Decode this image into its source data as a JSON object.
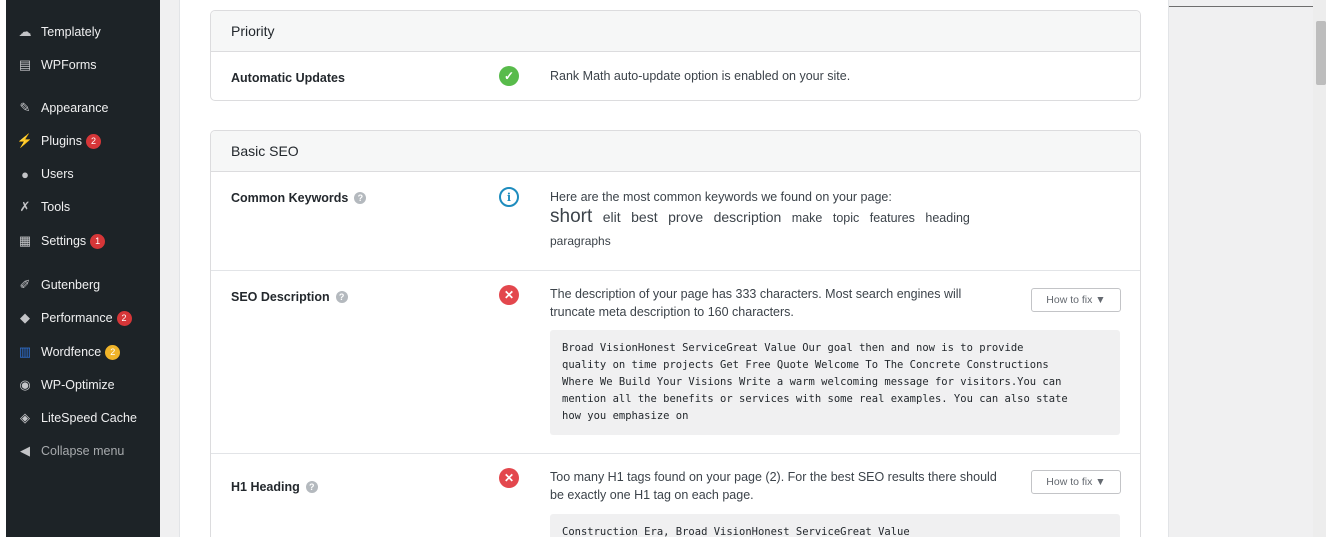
{
  "sidebar": {
    "items": [
      {
        "label": "Templately",
        "icon": "templately-icon"
      },
      {
        "label": "WPForms",
        "icon": "wpforms-icon"
      },
      {
        "label": "Appearance",
        "icon": "paintbrush-icon"
      },
      {
        "label": "Plugins",
        "icon": "plugin-icon",
        "badge": "2"
      },
      {
        "label": "Users",
        "icon": "users-icon"
      },
      {
        "label": "Tools",
        "icon": "wrench-icon"
      },
      {
        "label": "Settings",
        "icon": "settings-icon",
        "badge": "1"
      },
      {
        "label": "Gutenberg",
        "icon": "pencil-icon"
      },
      {
        "label": "Performance",
        "icon": "gauge-icon",
        "badge": "2"
      },
      {
        "label": "Wordfence",
        "icon": "wordfence-icon",
        "badge": "2"
      },
      {
        "label": "WP-Optimize",
        "icon": "optimize-icon"
      },
      {
        "label": "LiteSpeed Cache",
        "icon": "litespeed-icon"
      },
      {
        "label": "Collapse menu",
        "icon": "collapse-icon"
      }
    ]
  },
  "priority": {
    "title": "Priority",
    "auto_updates": {
      "label": "Automatic Updates",
      "message": "Rank Math auto-update option is enabled on your site."
    }
  },
  "basic_seo": {
    "title": "Basic SEO",
    "common_keywords": {
      "label": "Common Keywords",
      "message": "Here are the most common keywords we found on your page:",
      "keywords": [
        "short",
        "elit",
        "best",
        "prove",
        "description",
        "make",
        "topic",
        "features",
        "heading",
        "paragraphs"
      ]
    },
    "seo_description": {
      "label": "SEO Description",
      "message_line1": "The description of your page has 333 characters. Most search engines will",
      "message_line2": "truncate meta description to 160 characters.",
      "fix_label": "How to fix ▼",
      "code_lines": [
        "Broad VisionHonest ServiceGreat Value Our goal then and now is to provide",
        "quality on time projects Get Free Quote Welcome To The Concrete Constructions",
        "Where We Build Your Visions Write a warm welcoming message for visitors.You can",
        "mention all the benefits or services with some real examples. You can also state",
        "how you emphasize on"
      ]
    },
    "h1_heading": {
      "label": "H1 Heading",
      "message_line1": "Too many H1 tags found on your page (2). For the best SEO results there should",
      "message_line2": "be exactly one H1 tag on each page.",
      "fix_label": "How to fix ▼",
      "code_lines": [
        "Construction Era, Broad VisionHonest ServiceGreat Value"
      ]
    }
  },
  "help_glyph": "?",
  "colors": {
    "success": "#58bb4b",
    "error": "#e3474d",
    "info": "#1e8cbe",
    "sidebar": "#1d2327"
  }
}
